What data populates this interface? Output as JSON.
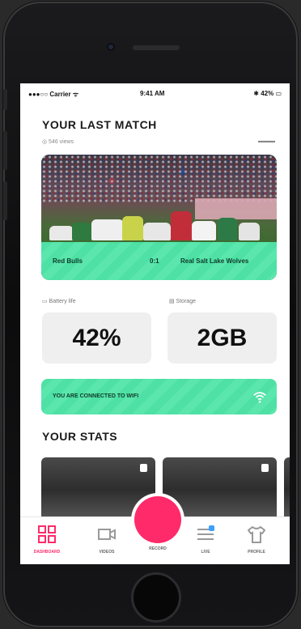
{
  "status": {
    "carrier": "●●●○○ Carrier ᯤ",
    "time": "9:41 AM",
    "battery": "✱ 42% ▭"
  },
  "last_match": {
    "title": "YOUR LAST MATCH",
    "views": "◎ 546 views",
    "tag": "▬▬▬",
    "team_a": "Red Bulls",
    "score": "0:1",
    "team_b": "Real Salt Lake Wolves"
  },
  "stats_row": {
    "battery_label": "▭ Battery life",
    "battery_value": "42%",
    "storage_label": "▤ Storage",
    "storage_value": "2GB"
  },
  "cta": {
    "label": "YOU ARE CONNECTED TO WIFI"
  },
  "your_stats": {
    "title": "YOUR STATS"
  },
  "tabs": [
    {
      "label": "DASHBOARD"
    },
    {
      "label": "VIDEOS"
    },
    {
      "label": "RECORD"
    },
    {
      "label": "LIVE"
    },
    {
      "label": "PROFILE"
    }
  ],
  "colors": {
    "accent": "#ff2a6a",
    "mint": "#4ee0a4"
  },
  "icons": {
    "home": "grid-icon",
    "videos": "video-icon",
    "live": "list-icon",
    "profile": "shirt-icon"
  }
}
